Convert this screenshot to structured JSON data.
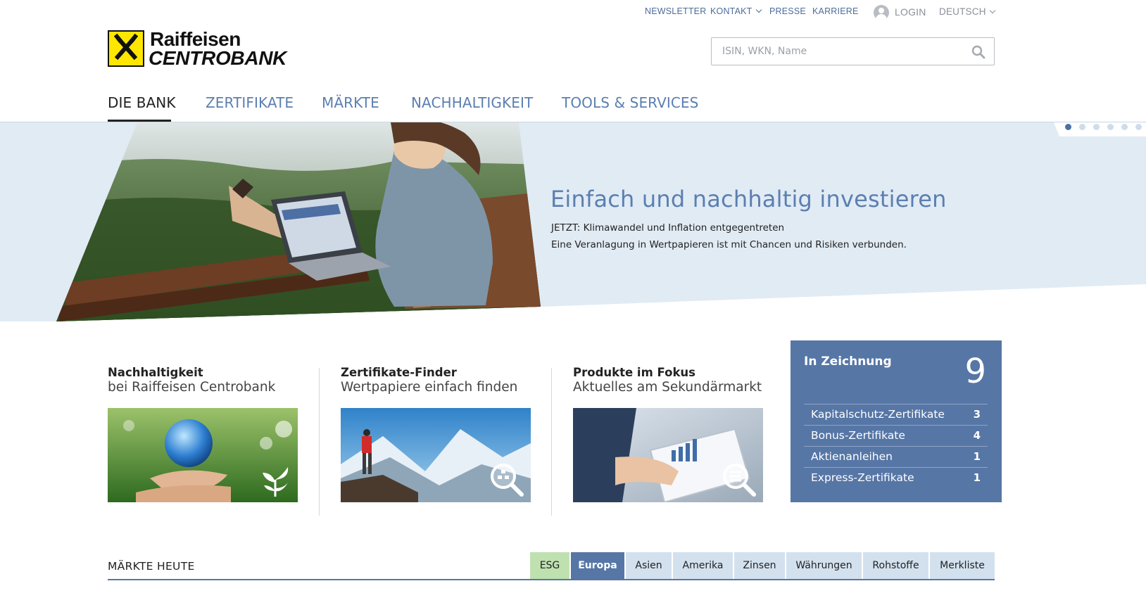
{
  "topnav": {
    "newsletter": "NEWSLETTER",
    "kontakt": "KONTAKT",
    "presse": "PRESSE",
    "karriere": "KARRIERE",
    "login": "LOGIN",
    "language": "DEUTSCH"
  },
  "logo": {
    "line1": "Raiffeisen",
    "line2": "CENTROBANK"
  },
  "search": {
    "placeholder": "ISIN, WKN, Name"
  },
  "mainnav": {
    "tabs": [
      "DIE BANK",
      "ZERTIFIKATE",
      "MÄRKTE",
      "NACHHALTIGKEIT",
      "TOOLS & SERVICES"
    ],
    "active": "DIE BANK"
  },
  "hero": {
    "title": "Einfach und nachhaltig investieren",
    "line1": "JETZT: Klimawandel und Inflation entgegentreten",
    "line2": "Eine Veranlagung in Wertpapieren ist mit Chancen und Risiken verbunden.",
    "slides": 6,
    "active_slide": 1
  },
  "teasers": [
    {
      "title": "Nachhaltigkeit",
      "subtitle": "bei Raiffeisen Centrobank",
      "icon": "plant-icon"
    },
    {
      "title": "Zertifikate-Finder",
      "subtitle": "Wertpapiere einfach finden",
      "icon": "search-icon"
    },
    {
      "title": "Produkte im Fokus",
      "subtitle": "Aktuelles am Sekundärmarkt",
      "icon": "search-list-icon"
    }
  ],
  "zeichnung": {
    "title": "In Zeichnung",
    "count": "9",
    "rows": [
      {
        "label": "Kapitalschutz-Zertifikate",
        "count": "3"
      },
      {
        "label": "Bonus-Zertifikate",
        "count": "4"
      },
      {
        "label": "Aktienanleihen",
        "count": "1"
      },
      {
        "label": "Express-Zertifikate",
        "count": "1"
      }
    ]
  },
  "maerkte": {
    "label": "MÄRKTE HEUTE",
    "tabs": [
      "ESG",
      "Europa",
      "Asien",
      "Amerika",
      "Zinsen",
      "Währungen",
      "Rohstoffe",
      "Merkliste"
    ],
    "active": "Europa"
  },
  "colors": {
    "accent": "#5676a6",
    "link": "#4d6d99",
    "hero_bg": "#e1ebf4",
    "esg": "#bfe1b0",
    "tab_bg": "#d3e1ef",
    "logo_yellow": "#fee600"
  }
}
